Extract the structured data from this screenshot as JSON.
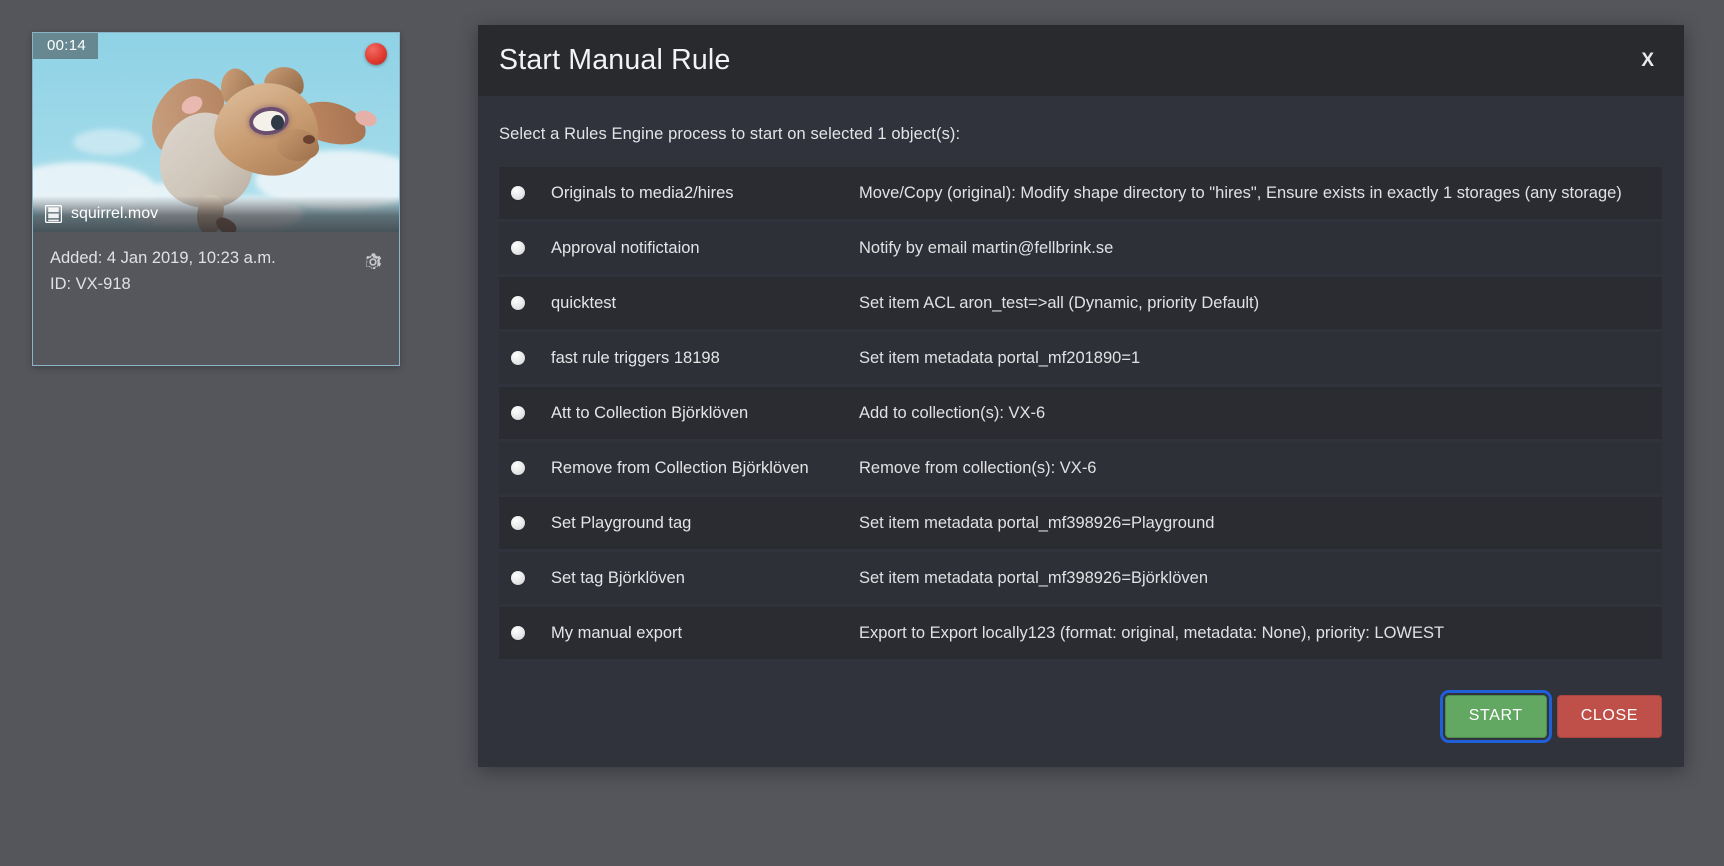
{
  "asset_card": {
    "duration_badge": "00:14",
    "record_dot_icon": "record-dot-icon",
    "filename": "squirrel.mov",
    "filename_icon": "film-strip-icon",
    "added_label": "Added: 4 Jan 2019, 10:23 a.m.",
    "id_label": "ID: VX-918",
    "settings_icon": "gear-icon",
    "border_color": "#8ab4c8"
  },
  "modal": {
    "title": "Start Manual Rule",
    "close_x_label": "X",
    "subtitle": "Select a Rules Engine process to start on selected 1 object(s):",
    "rules": [
      {
        "name": "Originals to media2/hires",
        "description": "Move/Copy (original): Modify shape directory to \"hires\", Ensure exists in exactly 1 storages (any storage)",
        "selected": false
      },
      {
        "name": "Approval notifictaion",
        "description": "Notify by email martin@fellbrink.se",
        "selected": false
      },
      {
        "name": "quicktest",
        "description": "Set item ACL aron_test=>all (Dynamic, priority Default)",
        "selected": false
      },
      {
        "name": "fast rule triggers 18198",
        "description": "Set item metadata portal_mf201890=1",
        "selected": false
      },
      {
        "name": "Att to Collection Björklöven",
        "description": "Add to collection(s): VX-6",
        "selected": false
      },
      {
        "name": "Remove from Collection Björklöven",
        "description": "Remove from collection(s): VX-6",
        "selected": false
      },
      {
        "name": "Set Playground tag",
        "description": "Set item metadata portal_mf398926=Playground",
        "selected": false
      },
      {
        "name": "Set tag Björklöven",
        "description": "Set item metadata portal_mf398926=Björklöven",
        "selected": false
      },
      {
        "name": "My manual export",
        "description": "Export to Export locally123 (format: original, metadata: None), priority: LOWEST",
        "selected": false
      }
    ],
    "footer": {
      "start_label": "START",
      "close_label": "CLOSE",
      "start_color": "#62a862",
      "close_color": "#bf5049",
      "focus_ring_color": "#1f5fd8"
    }
  },
  "page": {
    "background_color": "#54565c",
    "modal_background": "#31333c",
    "modal_header_background": "#282a2e",
    "row_background": "#2a2c31",
    "row_background_alt": "#2e3037"
  }
}
